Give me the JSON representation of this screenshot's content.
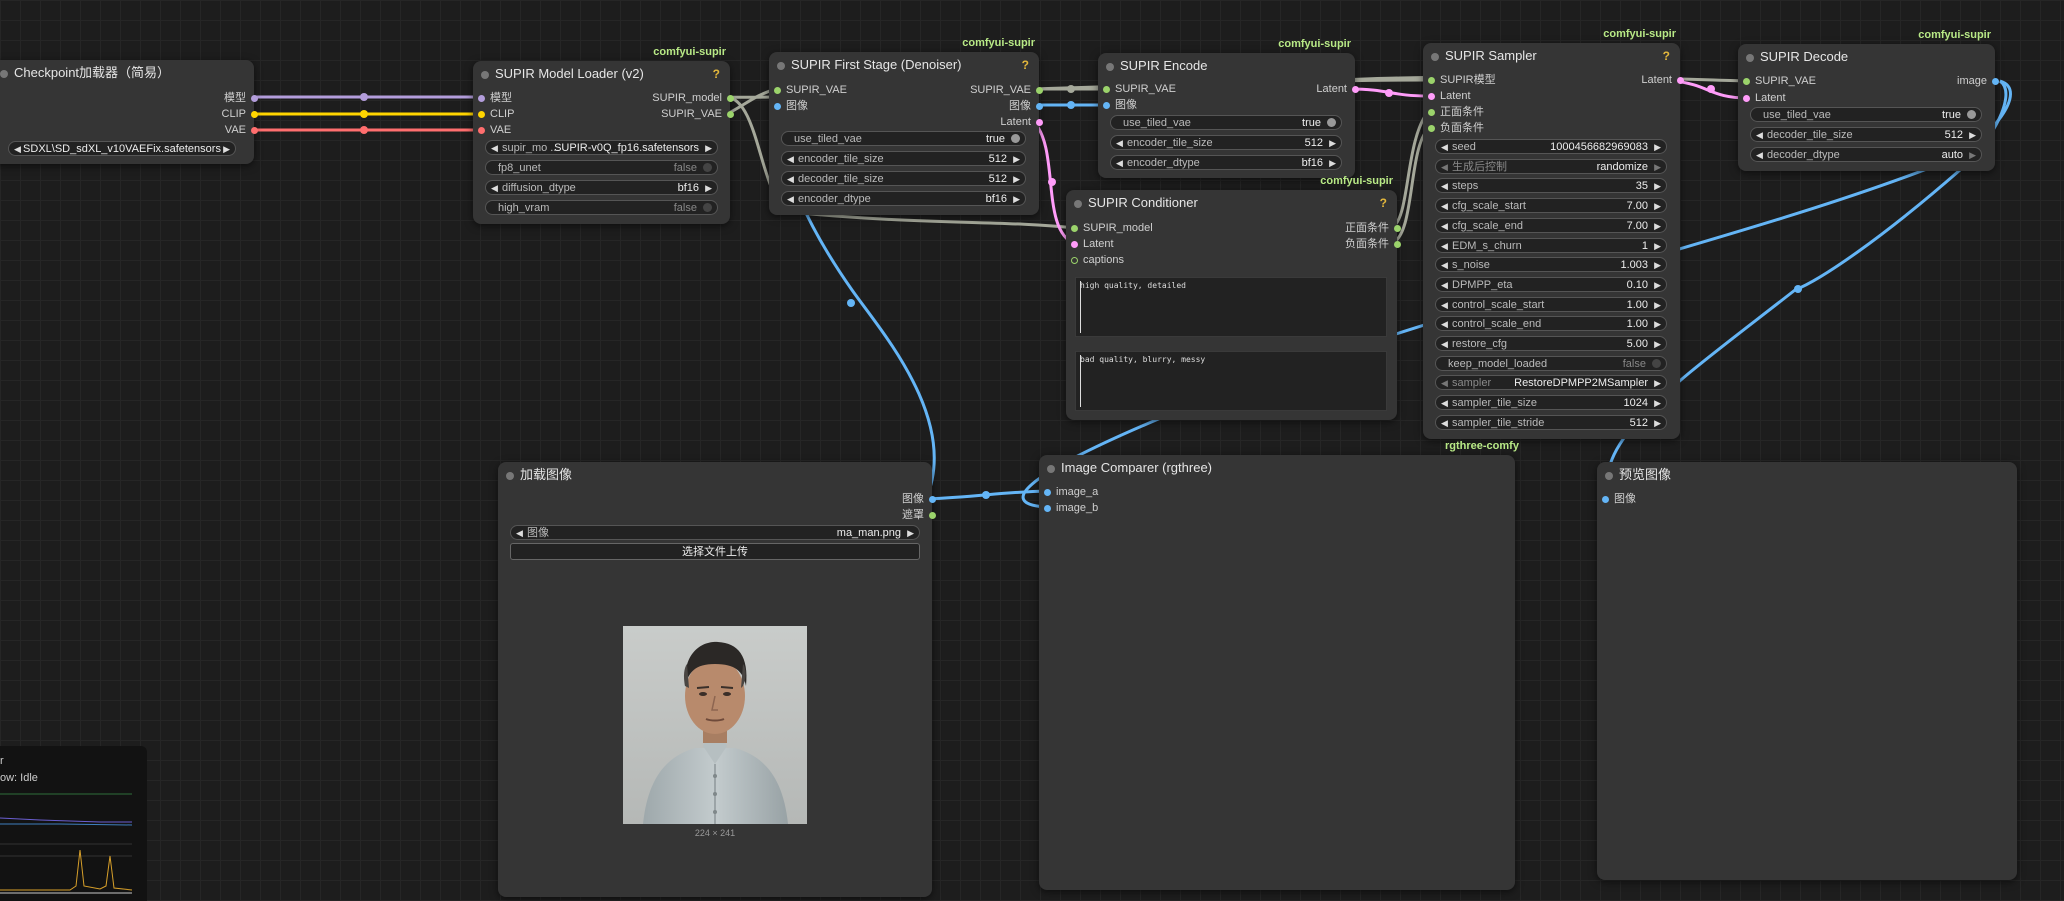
{
  "badges": {
    "supir": "comfyui-supir",
    "rgthree": "rgthree-comfy"
  },
  "help_mark": "?",
  "checkpoint_loader": {
    "title": "Checkpoint加载器（简易）",
    "outputs": [
      "模型",
      "CLIP",
      "VAE"
    ],
    "ckpt_value": "SDXL\\SD_sdXL_v10VAEFix.safetensors"
  },
  "model_loader": {
    "title": "SUPIR Model Loader (v2)",
    "inputs": [
      "模型",
      "CLIP",
      "VAE"
    ],
    "outputs": [
      "SUPIR_model",
      "SUPIR_VAE"
    ],
    "widgets": [
      {
        "label": "supir_mo ...",
        "value": "SUPIR-v0Q_fp16.safetensors"
      },
      {
        "label": "fp8_unet",
        "value": "false"
      },
      {
        "label": "diffusion_dtype",
        "value": "bf16"
      },
      {
        "label": "high_vram",
        "value": "false"
      }
    ]
  },
  "first_stage": {
    "title": "SUPIR First Stage (Denoiser)",
    "inputs": [
      "SUPIR_VAE",
      "图像"
    ],
    "outputs": [
      "SUPIR_VAE",
      "图像",
      "Latent"
    ],
    "widgets": [
      {
        "label": "use_tiled_vae",
        "value": "true"
      },
      {
        "label": "encoder_tile_size",
        "value": "512"
      },
      {
        "label": "decoder_tile_size",
        "value": "512"
      },
      {
        "label": "encoder_dtype",
        "value": "bf16"
      }
    ]
  },
  "encode": {
    "title": "SUPIR Encode",
    "inputs": [
      "SUPIR_VAE",
      "图像"
    ],
    "outputs": [
      "Latent"
    ],
    "widgets": [
      {
        "label": "use_tiled_vae",
        "value": "true"
      },
      {
        "label": "encoder_tile_size",
        "value": "512"
      },
      {
        "label": "encoder_dtype",
        "value": "bf16"
      }
    ]
  },
  "conditioner": {
    "title": "SUPIR Conditioner",
    "inputs": [
      "SUPIR_model",
      "Latent",
      "captions"
    ],
    "outputs": [
      "正面条件",
      "负面条件"
    ],
    "positive_prompt": "high quality, detailed",
    "negative_prompt": "bad quality, blurry, messy"
  },
  "sampler": {
    "title": "SUPIR Sampler",
    "inputs": [
      "SUPIR模型",
      "Latent",
      "正面条件",
      "负面条件"
    ],
    "outputs": [
      "Latent"
    ],
    "widgets": [
      {
        "label": "seed",
        "value": "1000456682969083"
      },
      {
        "label": "生成后控制",
        "value": "randomize"
      },
      {
        "label": "steps",
        "value": "35"
      },
      {
        "label": "cfg_scale_start",
        "value": "7.00"
      },
      {
        "label": "cfg_scale_end",
        "value": "7.00"
      },
      {
        "label": "EDM_s_churn",
        "value": "1"
      },
      {
        "label": "s_noise",
        "value": "1.003"
      },
      {
        "label": "DPMPP_eta",
        "value": "0.10"
      },
      {
        "label": "control_scale_start",
        "value": "1.00"
      },
      {
        "label": "control_scale_end",
        "value": "1.00"
      },
      {
        "label": "restore_cfg",
        "value": "5.00"
      },
      {
        "label": "keep_model_loaded",
        "value": "false"
      },
      {
        "label": "sampler",
        "value": "RestoreDPMPP2MSampler"
      },
      {
        "label": "sampler_tile_size",
        "value": "1024"
      },
      {
        "label": "sampler_tile_stride",
        "value": "512"
      }
    ]
  },
  "decode": {
    "title": "SUPIR Decode",
    "inputs": [
      "SUPIR_VAE",
      "Latent"
    ],
    "outputs": [
      "image"
    ],
    "widgets": [
      {
        "label": "use_tiled_vae",
        "value": "true"
      },
      {
        "label": "decoder_tile_size",
        "value": "512"
      },
      {
        "label": "decoder_dtype",
        "value": "auto"
      }
    ]
  },
  "load_image": {
    "title": "加载图像",
    "outputs": [
      "图像",
      "遮罩"
    ],
    "image_label": "图像",
    "image_value": "ma_man.png",
    "upload_button": "选择文件上传",
    "image_size": "224 × 241"
  },
  "comparer": {
    "title": "Image Comparer (rgthree)",
    "inputs": [
      "image_a",
      "image_b"
    ]
  },
  "preview": {
    "title": "预览图像",
    "inputs": [
      "图像"
    ]
  },
  "monitor": {
    "line1": "r",
    "line2": "ow: Idle"
  },
  "colors": {
    "model": "#b39ddb",
    "clip": "#ffd500",
    "vae": "#ff6e6e",
    "image": "#64b5f6",
    "latent": "#ff9cf9",
    "conditioning": "#ffa931",
    "supir": "#9bd36b",
    "link_gray": "#a5a89a",
    "badge": "#b8e986"
  }
}
